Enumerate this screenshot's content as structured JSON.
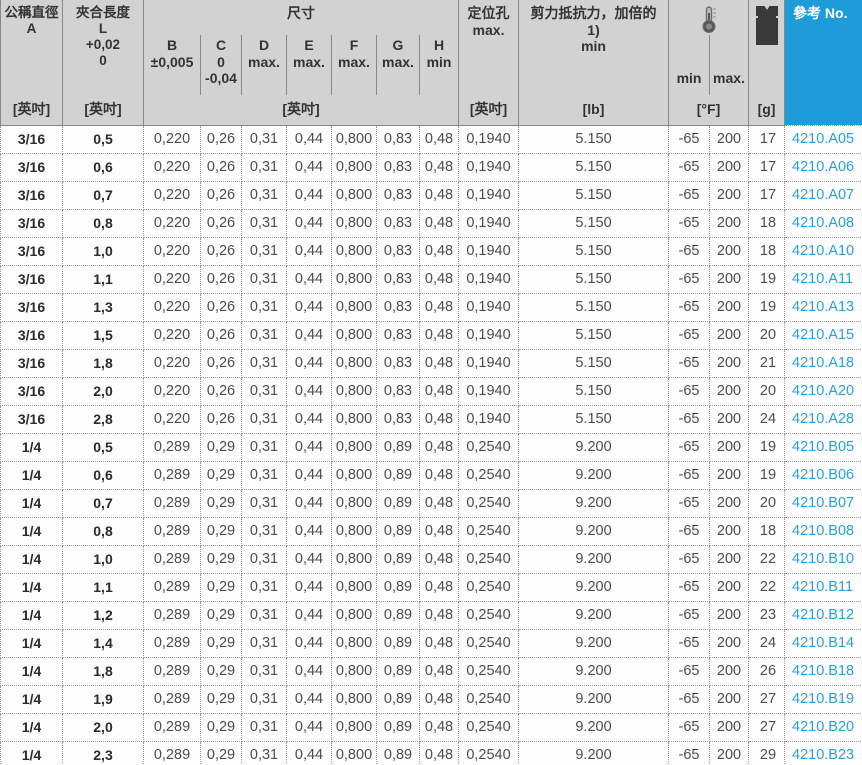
{
  "colors": {
    "accent_blue": "#1e9cd9",
    "link_blue": "#2b9fd9",
    "header_bg": "#d2d2d2",
    "border_dotted": "#9b9b9b",
    "header_border": "#888888"
  },
  "icons": {
    "temperature": "thermometer-icon",
    "mass": "weight-icon"
  },
  "header": {
    "col_a": "公稱直徑\nA",
    "col_l": "夾合長度\nL\n+0,02\n0",
    "dim_group": "尺寸",
    "sub_b": "B\n±0,005",
    "sub_c": "C\n0\n-0,04",
    "sub_d": "D\nmax.",
    "sub_e": "E\nmax.",
    "sub_f": "F\nmax.",
    "sub_g": "G\nmax.",
    "sub_h": "H\nmin",
    "hole": "定位孔\nmax.",
    "shear": "剪力抵抗力，加倍的\n1)\nmin",
    "temp_min": "min",
    "temp_max": "max.",
    "ref": "參考 No.",
    "unit_inch": "[英吋]",
    "unit_lb": "[lb]",
    "unit_f": "[°F]",
    "unit_g": "[g]"
  },
  "rows": [
    [
      "3/16",
      "0,5",
      "0,220",
      "0,26",
      "0,31",
      "0,44",
      "0,800",
      "0,83",
      "0,48",
      "0,1940",
      "5.150",
      "-65",
      "200",
      "17",
      "4210.A05"
    ],
    [
      "3/16",
      "0,6",
      "0,220",
      "0,26",
      "0,31",
      "0,44",
      "0,800",
      "0,83",
      "0,48",
      "0,1940",
      "5.150",
      "-65",
      "200",
      "17",
      "4210.A06"
    ],
    [
      "3/16",
      "0,7",
      "0,220",
      "0,26",
      "0,31",
      "0,44",
      "0,800",
      "0,83",
      "0,48",
      "0,1940",
      "5.150",
      "-65",
      "200",
      "17",
      "4210.A07"
    ],
    [
      "3/16",
      "0,8",
      "0,220",
      "0,26",
      "0,31",
      "0,44",
      "0,800",
      "0,83",
      "0,48",
      "0,1940",
      "5.150",
      "-65",
      "200",
      "18",
      "4210.A08"
    ],
    [
      "3/16",
      "1,0",
      "0,220",
      "0,26",
      "0,31",
      "0,44",
      "0,800",
      "0,83",
      "0,48",
      "0,1940",
      "5.150",
      "-65",
      "200",
      "18",
      "4210.A10"
    ],
    [
      "3/16",
      "1,1",
      "0,220",
      "0,26",
      "0,31",
      "0,44",
      "0,800",
      "0,83",
      "0,48",
      "0,1940",
      "5.150",
      "-65",
      "200",
      "19",
      "4210.A11"
    ],
    [
      "3/16",
      "1,3",
      "0,220",
      "0,26",
      "0,31",
      "0,44",
      "0,800",
      "0,83",
      "0,48",
      "0,1940",
      "5.150",
      "-65",
      "200",
      "19",
      "4210.A13"
    ],
    [
      "3/16",
      "1,5",
      "0,220",
      "0,26",
      "0,31",
      "0,44",
      "0,800",
      "0,83",
      "0,48",
      "0,1940",
      "5.150",
      "-65",
      "200",
      "20",
      "4210.A15"
    ],
    [
      "3/16",
      "1,8",
      "0,220",
      "0,26",
      "0,31",
      "0,44",
      "0,800",
      "0,83",
      "0,48",
      "0,1940",
      "5.150",
      "-65",
      "200",
      "21",
      "4210.A18"
    ],
    [
      "3/16",
      "2,0",
      "0,220",
      "0,26",
      "0,31",
      "0,44",
      "0,800",
      "0,83",
      "0,48",
      "0,1940",
      "5.150",
      "-65",
      "200",
      "20",
      "4210.A20"
    ],
    [
      "3/16",
      "2,8",
      "0,220",
      "0,26",
      "0,31",
      "0,44",
      "0,800",
      "0,83",
      "0,48",
      "0,1940",
      "5.150",
      "-65",
      "200",
      "24",
      "4210.A28"
    ],
    [
      "1/4",
      "0,5",
      "0,289",
      "0,29",
      "0,31",
      "0,44",
      "0,800",
      "0,89",
      "0,48",
      "0,2540",
      "9.200",
      "-65",
      "200",
      "19",
      "4210.B05"
    ],
    [
      "1/4",
      "0,6",
      "0,289",
      "0,29",
      "0,31",
      "0,44",
      "0,800",
      "0,89",
      "0,48",
      "0,2540",
      "9.200",
      "-65",
      "200",
      "19",
      "4210.B06"
    ],
    [
      "1/4",
      "0,7",
      "0,289",
      "0,29",
      "0,31",
      "0,44",
      "0,800",
      "0,89",
      "0,48",
      "0,2540",
      "9.200",
      "-65",
      "200",
      "20",
      "4210.B07"
    ],
    [
      "1/4",
      "0,8",
      "0,289",
      "0,29",
      "0,31",
      "0,44",
      "0,800",
      "0,89",
      "0,48",
      "0,2540",
      "9.200",
      "-65",
      "200",
      "18",
      "4210.B08"
    ],
    [
      "1/4",
      "1,0",
      "0,289",
      "0,29",
      "0,31",
      "0,44",
      "0,800",
      "0,89",
      "0,48",
      "0,2540",
      "9.200",
      "-65",
      "200",
      "22",
      "4210.B10"
    ],
    [
      "1/4",
      "1,1",
      "0,289",
      "0,29",
      "0,31",
      "0,44",
      "0,800",
      "0,89",
      "0,48",
      "0,2540",
      "9.200",
      "-65",
      "200",
      "22",
      "4210.B11"
    ],
    [
      "1/4",
      "1,2",
      "0,289",
      "0,29",
      "0,31",
      "0,44",
      "0,800",
      "0,89",
      "0,48",
      "0,2540",
      "9.200",
      "-65",
      "200",
      "23",
      "4210.B12"
    ],
    [
      "1/4",
      "1,4",
      "0,289",
      "0,29",
      "0,31",
      "0,44",
      "0,800",
      "0,89",
      "0,48",
      "0,2540",
      "9.200",
      "-65",
      "200",
      "24",
      "4210.B14"
    ],
    [
      "1/4",
      "1,8",
      "0,289",
      "0,29",
      "0,31",
      "0,44",
      "0,800",
      "0,89",
      "0,48",
      "0,2540",
      "9.200",
      "-65",
      "200",
      "26",
      "4210.B18"
    ],
    [
      "1/4",
      "1,9",
      "0,289",
      "0,29",
      "0,31",
      "0,44",
      "0,800",
      "0,89",
      "0,48",
      "0,2540",
      "9.200",
      "-65",
      "200",
      "27",
      "4210.B19"
    ],
    [
      "1/4",
      "2,0",
      "0,289",
      "0,29",
      "0,31",
      "0,44",
      "0,800",
      "0,89",
      "0,48",
      "0,2540",
      "9.200",
      "-65",
      "200",
      "27",
      "4210.B20"
    ],
    [
      "1/4",
      "2,3",
      "0,289",
      "0,29",
      "0,31",
      "0,44",
      "0,800",
      "0,89",
      "0,48",
      "0,2540",
      "9.200",
      "-65",
      "200",
      "29",
      "4210.B23"
    ]
  ]
}
